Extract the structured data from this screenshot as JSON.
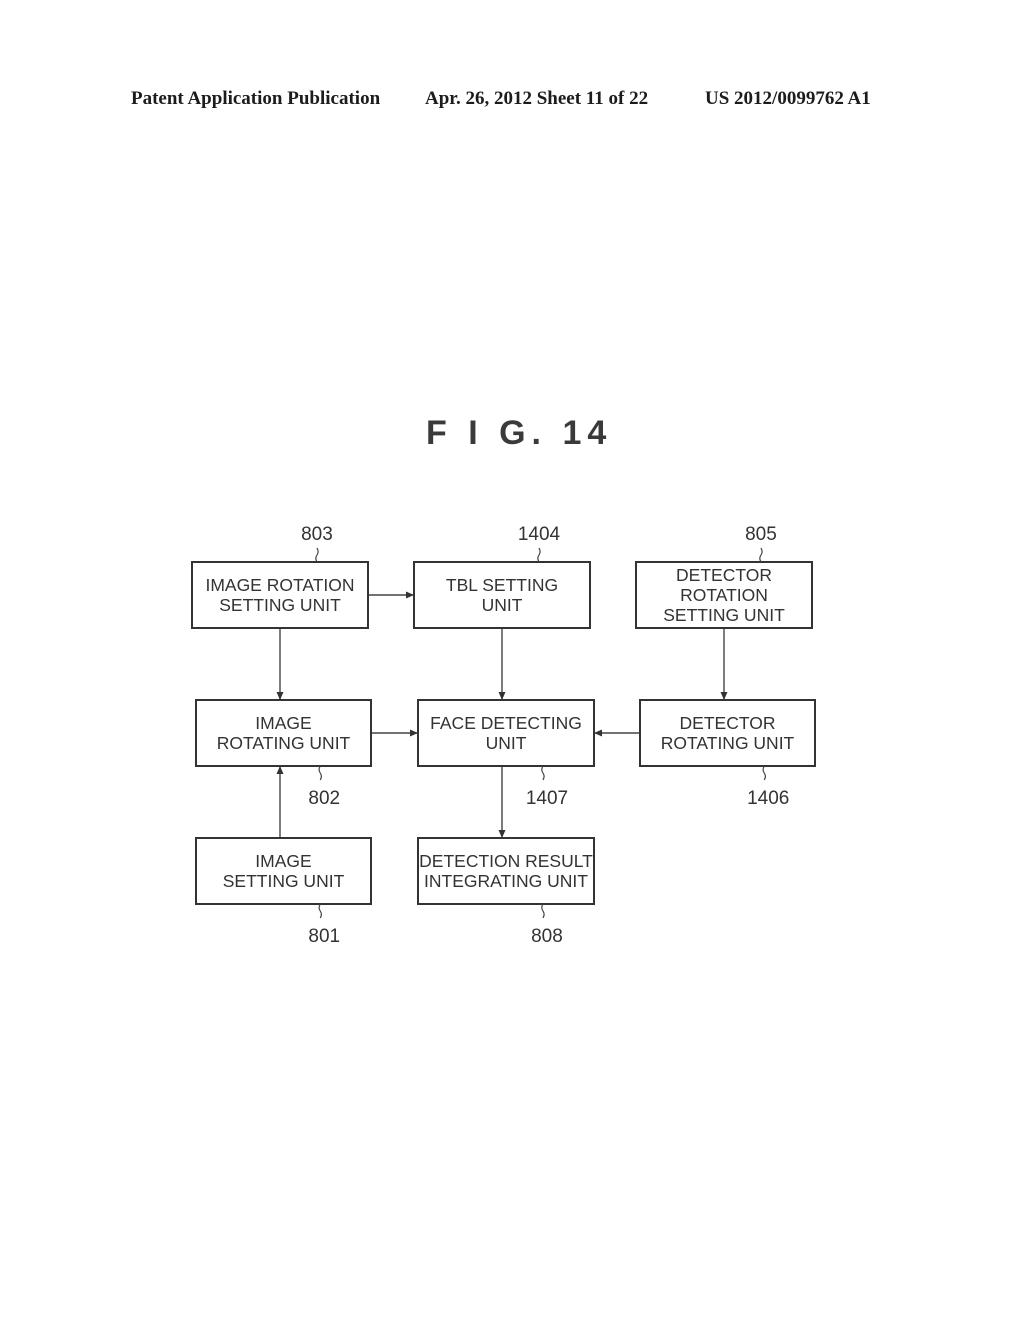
{
  "header": {
    "left": "Patent Application Publication",
    "middle": "Apr. 26, 2012  Sheet 11 of 22",
    "right": "US 2012/0099762 A1"
  },
  "figure": {
    "title": "F I G. 14",
    "blocks": [
      {
        "id": "803",
        "ref": "803",
        "lines": [
          "IMAGE ROTATION",
          "SETTING UNIT"
        ]
      },
      {
        "id": "1404",
        "ref": "1404",
        "lines": [
          "TBL SETTING",
          "UNIT"
        ]
      },
      {
        "id": "805",
        "ref": "805",
        "lines": [
          "DETECTOR",
          "ROTATION",
          "SETTING UNIT"
        ]
      },
      {
        "id": "802",
        "ref": "802",
        "lines": [
          "IMAGE",
          "ROTATING UNIT"
        ]
      },
      {
        "id": "1407",
        "ref": "1407",
        "lines": [
          "FACE DETECTING",
          "UNIT"
        ]
      },
      {
        "id": "1406",
        "ref": "1406",
        "lines": [
          "DETECTOR",
          "ROTATING UNIT"
        ]
      },
      {
        "id": "801",
        "ref": "801",
        "lines": [
          "IMAGE",
          "SETTING UNIT"
        ]
      },
      {
        "id": "808",
        "ref": "808",
        "lines": [
          "DETECTION RESULT",
          "INTEGRATING UNIT"
        ]
      }
    ],
    "connections": [
      {
        "from": "803",
        "to": "1404"
      },
      {
        "from": "803",
        "to": "802"
      },
      {
        "from": "1404",
        "to": "1407"
      },
      {
        "from": "805",
        "to": "1406"
      },
      {
        "from": "802",
        "to": "1407"
      },
      {
        "from": "1406",
        "to": "1407"
      },
      {
        "from": "801",
        "to": "802"
      },
      {
        "from": "1407",
        "to": "808"
      }
    ]
  }
}
